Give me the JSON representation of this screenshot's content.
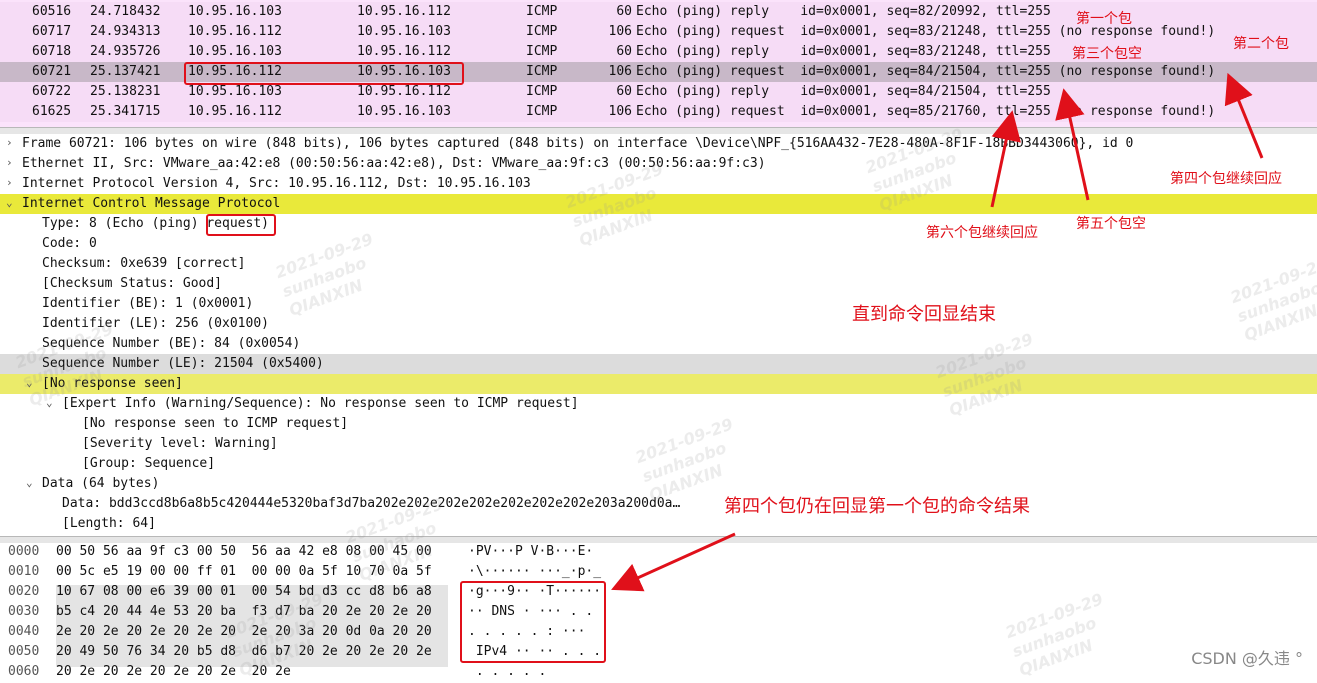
{
  "packets": [
    {
      "no": "60516",
      "time": "24.718432",
      "src": "10.95.16.103",
      "dst": "10.95.16.112",
      "proto": "ICMP",
      "len": "60",
      "info": "Echo (ping) reply    id=0x0001, seq=82/20992, ttl=255"
    },
    {
      "no": "60717",
      "time": "24.934313",
      "src": "10.95.16.112",
      "dst": "10.95.16.103",
      "proto": "ICMP",
      "len": "106",
      "info": "Echo (ping) request  id=0x0001, seq=83/21248, ttl=255 (no response found!)"
    },
    {
      "no": "60718",
      "time": "24.935726",
      "src": "10.95.16.103",
      "dst": "10.95.16.112",
      "proto": "ICMP",
      "len": "60",
      "info": "Echo (ping) reply    id=0x0001, seq=83/21248, ttl=255"
    },
    {
      "no": "60721",
      "time": "25.137421",
      "src": "10.95.16.112",
      "dst": "10.95.16.103",
      "proto": "ICMP",
      "len": "106",
      "info": "Echo (ping) request  id=0x0001, seq=84/21504, ttl=255 (no response found!)"
    },
    {
      "no": "60722",
      "time": "25.138231",
      "src": "10.95.16.103",
      "dst": "10.95.16.112",
      "proto": "ICMP",
      "len": "60",
      "info": "Echo (ping) reply    id=0x0001, seq=84/21504, ttl=255"
    },
    {
      "no": "61625",
      "time": "25.341715",
      "src": "10.95.16.112",
      "dst": "10.95.16.103",
      "proto": "ICMP",
      "len": "106",
      "info": "Echo (ping) request  id=0x0001, seq=85/21760, ttl=255 (no response found!)"
    }
  ],
  "details": [
    {
      "twisty": ">",
      "text": "Frame 60721: 106 bytes on wire (848 bits), 106 bytes captured (848 bits) on interface \\Device\\NPF_{516AA432-7E28-480A-8F1F-18BBD3443060}, id 0"
    },
    {
      "twisty": ">",
      "text": "Ethernet II, Src: VMware_aa:42:e8 (00:50:56:aa:42:e8), Dst: VMware_aa:9f:c3 (00:50:56:aa:9f:c3)"
    },
    {
      "twisty": ">",
      "text": "Internet Protocol Version 4, Src: 10.95.16.112, Dst: 10.95.16.103"
    },
    {
      "twisty": "v",
      "text": "Internet Control Message Protocol"
    },
    {
      "twisty": "",
      "text": "Type: 8 (Echo (ping) request)"
    },
    {
      "twisty": "",
      "text": "Code: 0"
    },
    {
      "twisty": "",
      "text": "Checksum: 0xe639 [correct]"
    },
    {
      "twisty": "",
      "text": "[Checksum Status: Good]"
    },
    {
      "twisty": "",
      "text": "Identifier (BE): 1 (0x0001)"
    },
    {
      "twisty": "",
      "text": "Identifier (LE): 256 (0x0100)"
    },
    {
      "twisty": "",
      "text": "Sequence Number (BE): 84 (0x0054)"
    },
    {
      "twisty": "",
      "text": "Sequence Number (LE): 21504 (0x5400)"
    },
    {
      "twisty": "v",
      "text": "[No response seen]"
    },
    {
      "twisty": "v",
      "text": "[Expert Info (Warning/Sequence): No response seen to ICMP request]"
    },
    {
      "twisty": "",
      "text": "[No response seen to ICMP request]"
    },
    {
      "twisty": "",
      "text": "[Severity level: Warning]"
    },
    {
      "twisty": "",
      "text": "[Group: Sequence]"
    },
    {
      "twisty": "v",
      "text": "Data (64 bytes)"
    },
    {
      "twisty": "",
      "text": "Data: bdd3ccd8b6a8b5c420444e5320baf3d7ba202e202e202e202e202e202e202e203a200d0a…"
    },
    {
      "twisty": "",
      "text": "[Length: 64]"
    }
  ],
  "bytes": [
    {
      "off": "0000",
      "hex": "00 50 56 aa 9f c3 00 50  56 aa 42 e8 08 00 45 00",
      "ascii": "·PV···P V·B···E·"
    },
    {
      "off": "0010",
      "hex": "00 5c e5 19 00 00 ff 01  00 00 0a 5f 10 70 0a 5f",
      "ascii": "·\\······ ···_·p·_"
    },
    {
      "off": "0020",
      "hex": "10 67 08 00 e6 39 00 01  00 54 bd d3 cc d8 b6 a8",
      "ascii": "·g···9·· ·T······"
    },
    {
      "off": "0030",
      "hex": "b5 c4 20 44 4e 53 20 ba  f3 d7 ba 20 2e 20 2e 20",
      "ascii": "·· DNS · ··· . . "
    },
    {
      "off": "0040",
      "hex": "2e 20 2e 20 2e 20 2e 20  2e 20 3a 20 0d 0a 20 20",
      "ascii": ". . . . . : ···  "
    },
    {
      "off": "0050",
      "hex": "20 49 50 76 34 20 b5 d8  d6 b7 20 2e 20 2e 20 2e",
      "ascii": " IPv4 ·· ·· . . ."
    },
    {
      "off": "0060",
      "hex": "20 2e 20 2e 20 2e 20 2e  20 2e",
      "ascii": " . . . . ."
    }
  ],
  "annotations": {
    "first_packet": "第一个包",
    "second_packet": "第二个包",
    "third_packet_empty": "第三个包空",
    "fourth_packet_continues": "第四个包继续回应",
    "fifth_packet_empty": "第五个包空",
    "sixth_packet_continues": "第六个包继续回应",
    "until_echo_ends": "直到命令回显结束",
    "fourth_still_echo": "第四个包仍在回显第一个包的命令结果"
  },
  "watermark": {
    "date": "2021-09-29",
    "user": "sunhaobo",
    "org": "QIANXIN"
  },
  "credit": "CSDN @久违 °",
  "colors": {
    "packet_bg": "#f6dcf6",
    "selected_bg": "#c8b8c8",
    "highlight_yellow": "#ebeb6a",
    "annotation_red": "#e0101a"
  }
}
